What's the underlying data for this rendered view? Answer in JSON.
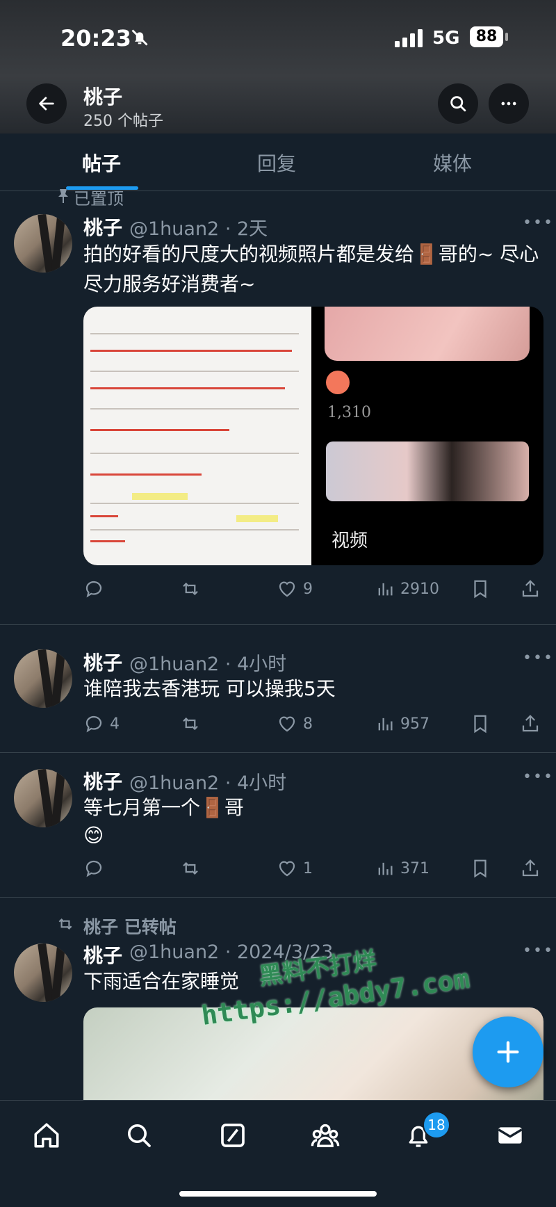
{
  "status_bar": {
    "time": "20:23",
    "network": "5G",
    "battery": "88"
  },
  "header": {
    "title": "桃子",
    "subtitle": "250 个帖子"
  },
  "tabs": [
    {
      "label": "帖子"
    },
    {
      "label": "回复"
    },
    {
      "label": "媒体"
    }
  ],
  "pinned_label": "已置顶",
  "posts": [
    {
      "name": "桃子",
      "meta": "@1huan2 · 2天",
      "text": "拍的好看的尺度大的视频照片都是发给🚪哥的~ 尽心尽力服务好消费者~",
      "stats": {
        "replies": "",
        "reposts": "",
        "likes": "9",
        "views": "2910"
      },
      "media": {
        "count_label": "1,310",
        "caption": "视频"
      }
    },
    {
      "name": "桃子",
      "meta": "@1huan2 · 4小时",
      "text": "谁陪我去香港玩 可以操我5天",
      "stats": {
        "replies": "4",
        "reposts": "",
        "likes": "8",
        "views": "957"
      }
    },
    {
      "name": "桃子",
      "meta": "@1huan2 · 4小时",
      "text": "等七月第一个🚪哥",
      "text2": "😊",
      "stats": {
        "replies": "",
        "reposts": "",
        "likes": "1",
        "views": "371"
      }
    },
    {
      "repost_label": "桃子 已转帖",
      "name": "桃子",
      "meta": "@1huan2 · 2024/3/23",
      "text": "下雨适合在家睡觉"
    }
  ],
  "watermark": {
    "line1": "黑料不打烊",
    "line2": "https://abdy7.com"
  },
  "tabbar": {
    "notifications_badge": "18"
  },
  "icons": [
    "back-arrow-icon",
    "search-icon",
    "more-icon",
    "pin-icon",
    "reply-icon",
    "repost-icon",
    "like-icon",
    "views-icon",
    "bookmark-icon",
    "share-icon",
    "compose-icon",
    "home-icon",
    "grok-icon",
    "communities-icon",
    "bell-icon",
    "mail-icon"
  ],
  "colors": {
    "background": "#15202b",
    "accent": "#1d9bf0",
    "muted": "#8b98a5"
  }
}
